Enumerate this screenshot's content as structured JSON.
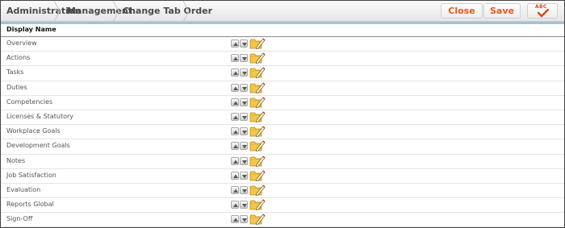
{
  "breadcrumb": {
    "items": [
      "Administration",
      "Management",
      "Change Tab Order"
    ]
  },
  "toolbar": {
    "close_label": "Close",
    "save_label": "Save",
    "spellcheck_label": "ABC"
  },
  "table": {
    "header": "Display Name",
    "rows": [
      "Overview",
      "Actions",
      "Tasks",
      "Duties",
      "Competencies",
      "Licenses & Statutory",
      "Workplace Goals",
      "Development Goals",
      "Notes",
      "Job Satisfaction",
      "Evaluation",
      "Reports Global",
      "Sign-Off"
    ]
  },
  "icons": {
    "move_up": "arrow-up-icon",
    "move_down": "arrow-down-icon",
    "edit": "folder-edit-icon",
    "spellcheck": "spellcheck-icon"
  },
  "colors": {
    "accent": "#e8571c",
    "header_band": "#9ec5d8"
  }
}
